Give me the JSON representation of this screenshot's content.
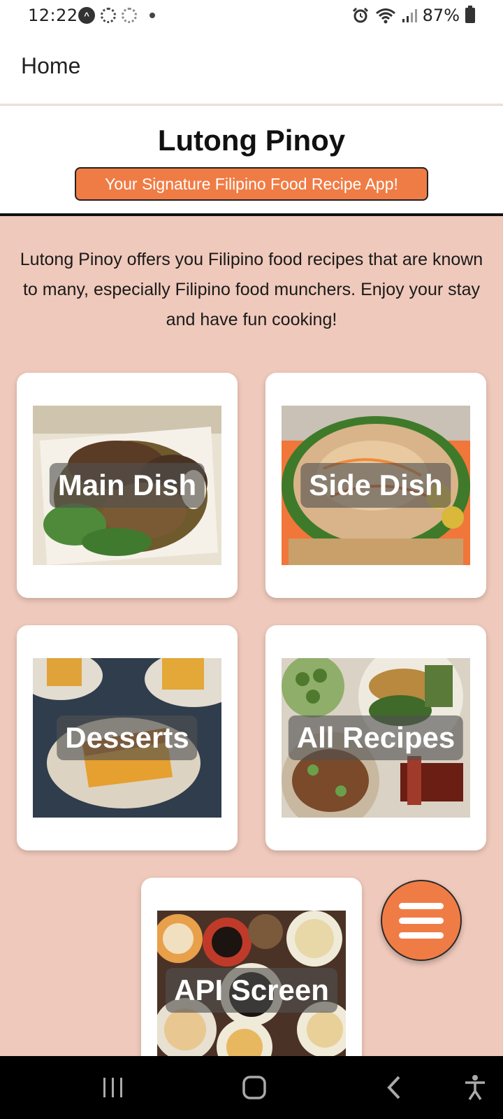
{
  "status_bar": {
    "time": "12:22",
    "battery": "87%",
    "icons": [
      "a-circle-icon",
      "settings-ring-icon",
      "sync-ring-icon",
      "dot-icon",
      "alarm-icon",
      "wifi-icon",
      "signal-icon",
      "battery-icon"
    ]
  },
  "header": {
    "title": "Home"
  },
  "banner": {
    "app_name": "Lutong Pinoy",
    "tagline": "Your Signature Filipino Food Recipe App!"
  },
  "intro_text": "Lutong Pinoy offers you Filipino food recipes that are known to many, especially Filipino food munchers. Enjoy your stay and have fun cooking!",
  "categories": [
    {
      "label": "Main Dish"
    },
    {
      "label": "Side Dish"
    },
    {
      "label": "Desserts"
    },
    {
      "label": "All Recipes"
    },
    {
      "label": "API Screen"
    }
  ],
  "fab": {
    "icon": "menu-icon"
  },
  "nav_bar": {
    "icons": [
      "recent-apps-icon",
      "home-icon",
      "back-icon",
      "accessibility-icon"
    ]
  },
  "colors": {
    "accent": "#f07c45",
    "background": "#efc9bb",
    "card": "#ffffff"
  }
}
